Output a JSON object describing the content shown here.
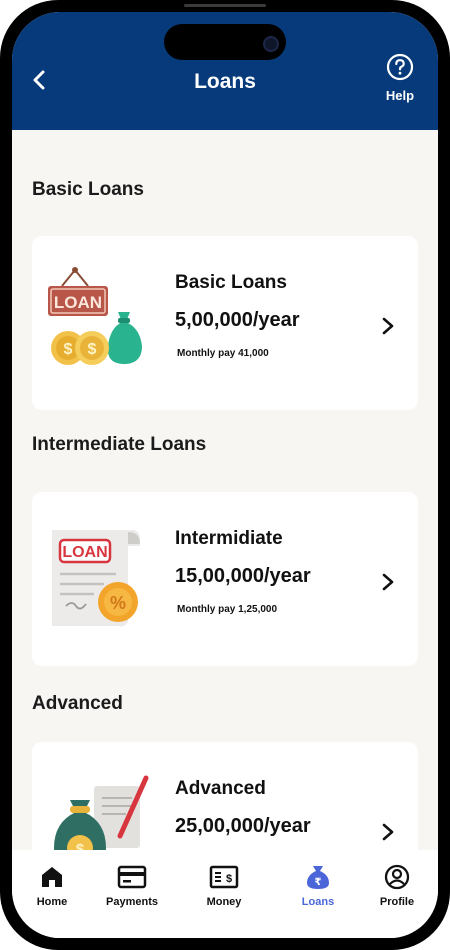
{
  "header": {
    "title": "Loans",
    "help_label": "Help"
  },
  "sections": [
    {
      "title": "Basic Loans",
      "card": {
        "name": "Basic Loans",
        "amount": "5,00,000/year",
        "monthly": "Monthly pay 41,000",
        "art_text": "LOAN"
      }
    },
    {
      "title": "Intermediate Loans",
      "card": {
        "name": "Intermidiate",
        "amount": "15,00,000/year",
        "monthly": "Monthly pay 1,25,000",
        "art_text": "LOAN"
      }
    },
    {
      "title": "Advanced",
      "card": {
        "name": "Advanced",
        "amount": "25,00,000/year",
        "monthly": ""
      }
    }
  ],
  "nav": {
    "items": [
      {
        "label": "Home",
        "icon": "home-icon"
      },
      {
        "label": "Payments",
        "icon": "card-icon"
      },
      {
        "label": "Money",
        "icon": "cash-icon"
      },
      {
        "label": "Loans",
        "icon": "money-bag-icon",
        "active": true
      },
      {
        "label": "Profile",
        "icon": "profile-icon"
      }
    ]
  },
  "colors": {
    "header_bg": "#073a7a",
    "page_bg": "#f7f6f3",
    "active_nav": "#4a66d8"
  }
}
